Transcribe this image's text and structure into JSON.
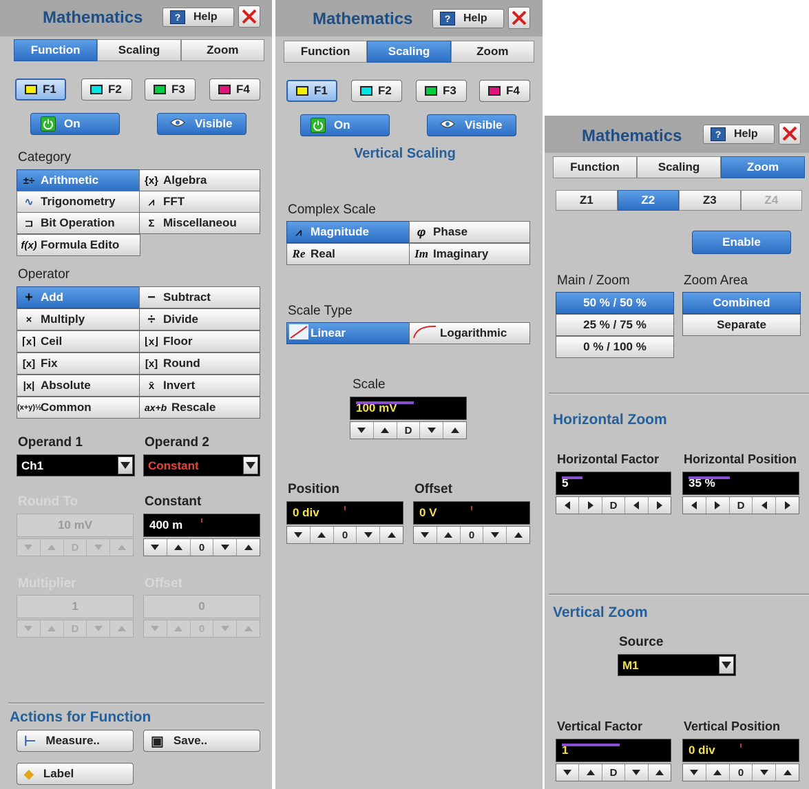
{
  "colors": {
    "accent": "#2d6fc4",
    "f1": "#f5f000",
    "f2": "#00e5e5",
    "f3": "#00cc44",
    "f4": "#e0147a",
    "bar": "#8a4fd0"
  },
  "p1": {
    "title": "Mathematics",
    "help": "Help",
    "tabs": [
      "Function",
      "Scaling",
      "Zoom"
    ],
    "functions": [
      "F1",
      "F2",
      "F3",
      "F4"
    ],
    "on": "On",
    "visible": "Visible",
    "category_label": "Category",
    "category": [
      "Arithmetic",
      "Algebra",
      "Trigonometry",
      "FFT",
      "Bit Operation",
      "Miscellaneou",
      "Formula Edito"
    ],
    "operator_label": "Operator",
    "operators": [
      "Add",
      "Subtract",
      "Multiply",
      "Divide",
      "Ceil",
      "Floor",
      "Fix",
      "Round",
      "Absolute",
      "Invert",
      "Common",
      "Rescale"
    ],
    "operand1_label": "Operand 1",
    "operand1": "Ch1",
    "operand2_label": "Operand 2",
    "operand2": "Constant",
    "roundto_label": "Round To",
    "roundto": "10 mV",
    "constant_label": "Constant",
    "constant": "400 m",
    "multiplier_label": "Multiplier",
    "multiplier": "1",
    "offset_label": "Offset",
    "offset": "0",
    "actions_label": "Actions for Function",
    "measure": "Measure..",
    "save": "Save..",
    "label": "Label"
  },
  "p2": {
    "title": "Mathematics",
    "help": "Help",
    "tabs": [
      "Function",
      "Scaling",
      "Zoom"
    ],
    "functions": [
      "F1",
      "F2",
      "F3",
      "F4"
    ],
    "on": "On",
    "visible": "Visible",
    "vertical_scaling": "Vertical Scaling",
    "complex_label": "Complex Scale",
    "complex": [
      "Magnitude",
      "Phase",
      "Real",
      "Imaginary"
    ],
    "scaletype_label": "Scale Type",
    "scaletype": [
      "Linear",
      "Logarithmic"
    ],
    "scale_label": "Scale",
    "scale": "100 mV",
    "position_label": "Position",
    "position": "0 div",
    "offset_label": "Offset",
    "offset": "0 V"
  },
  "p3": {
    "title": "Mathematics",
    "help": "Help",
    "tabs": [
      "Function",
      "Scaling",
      "Zoom"
    ],
    "zooms": [
      "Z1",
      "Z2",
      "Z3",
      "Z4"
    ],
    "enable": "Enable",
    "mainzoom_label": "Main / Zoom",
    "mainzoom": [
      "50 % / 50 %",
      "25 % / 75 %",
      "0 % / 100 %"
    ],
    "zoomarea_label": "Zoom Area",
    "zoomarea": [
      "Combined",
      "Separate"
    ],
    "hzoom": "Horizontal Zoom",
    "hfactor_label": "Horizontal Factor",
    "hfactor": "5",
    "hpos_label": "Horizontal Position",
    "hpos": "35 %",
    "vzoom": "Vertical Zoom",
    "source_label": "Source",
    "source": "M1",
    "vfactor_label": "Vertical Factor",
    "vfactor": "1",
    "vpos_label": "Vertical Position",
    "vpos": "0 div"
  }
}
